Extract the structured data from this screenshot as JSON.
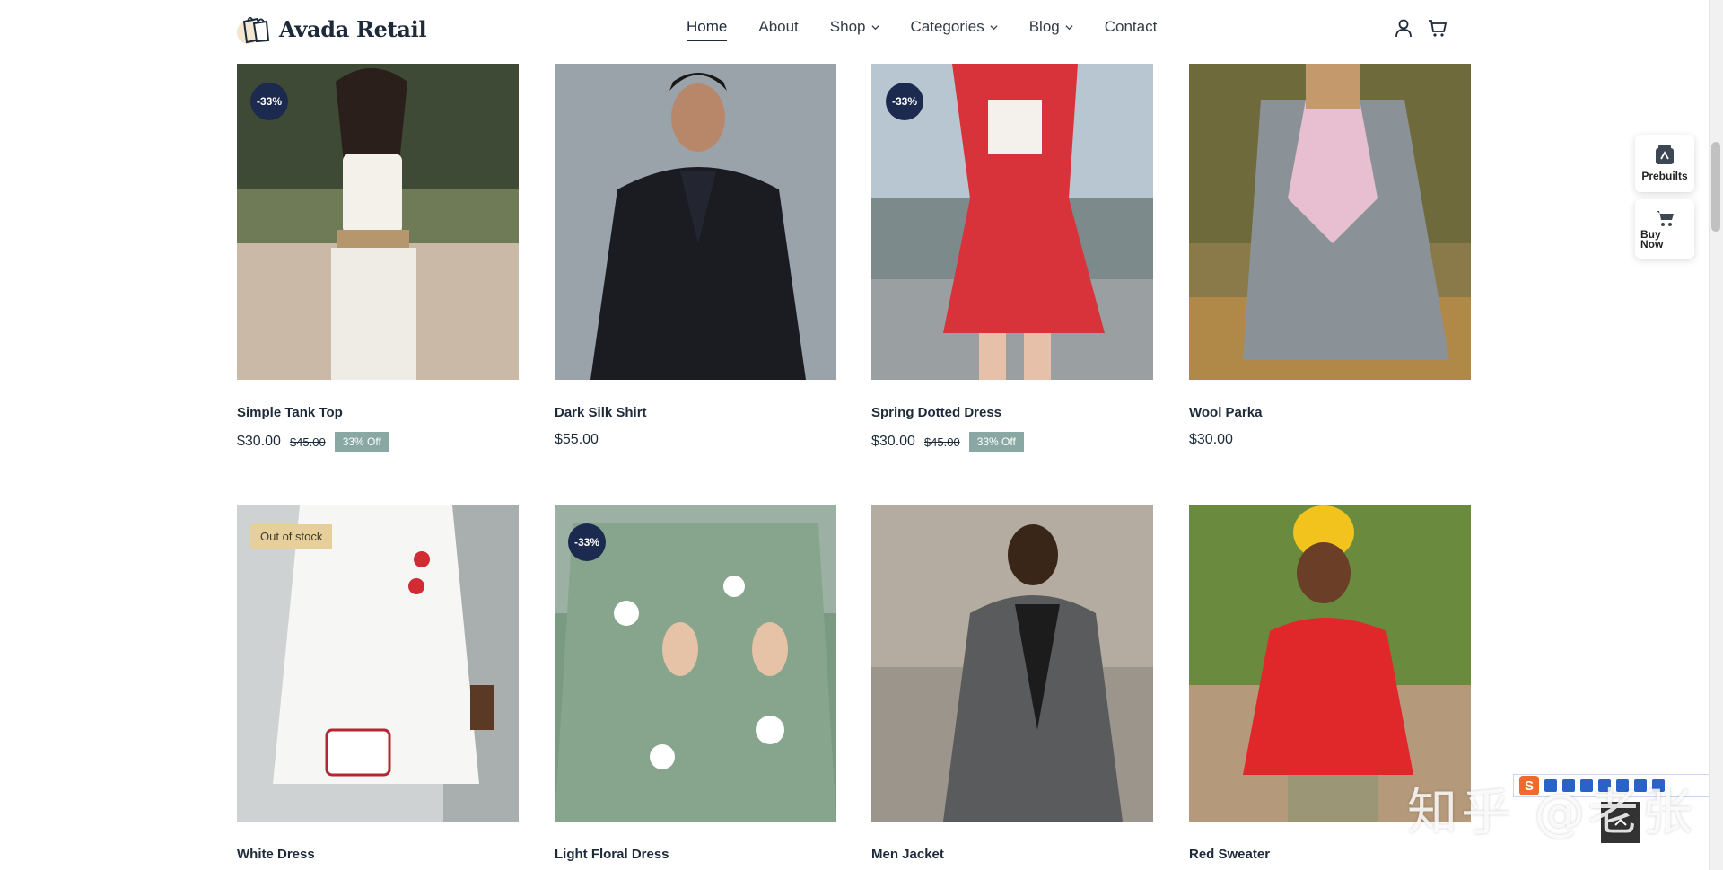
{
  "brand": {
    "name": "Avada Retail"
  },
  "nav": {
    "items": [
      {
        "label": "Home",
        "dropdown": false,
        "active": true
      },
      {
        "label": "About",
        "dropdown": false
      },
      {
        "label": "Shop",
        "dropdown": true
      },
      {
        "label": "Categories",
        "dropdown": true
      },
      {
        "label": "Blog",
        "dropdown": true
      },
      {
        "label": "Contact",
        "dropdown": false
      }
    ]
  },
  "header_icons": [
    "user-icon",
    "cart-icon"
  ],
  "products": [
    {
      "name": "Simple Tank Top",
      "price": "$30.00",
      "old_price": "$45.00",
      "off": "33% Off",
      "badge": "-33%"
    },
    {
      "name": "Dark Silk Shirt",
      "price": "$55.00"
    },
    {
      "name": "Spring Dotted Dress",
      "price": "$30.00",
      "old_price": "$45.00",
      "off": "33% Off",
      "badge": "-33%"
    },
    {
      "name": "Wool Parka",
      "price": "$30.00"
    },
    {
      "name": "White Dress",
      "stock_badge": "Out of stock"
    },
    {
      "name": "Light Floral Dress",
      "badge": "-33%"
    },
    {
      "name": "Men Jacket"
    },
    {
      "name": "Red Sweater"
    }
  ],
  "side_buttons": {
    "prebuilts": "Prebuilts",
    "buy_now": "Buy Now"
  },
  "watermark": {
    "text": "知乎 @老张"
  },
  "colors": {
    "brand_navy": "#1b2a4e",
    "badge_green": "#8aa8a3",
    "stock_badge": "#e6cf9a"
  }
}
